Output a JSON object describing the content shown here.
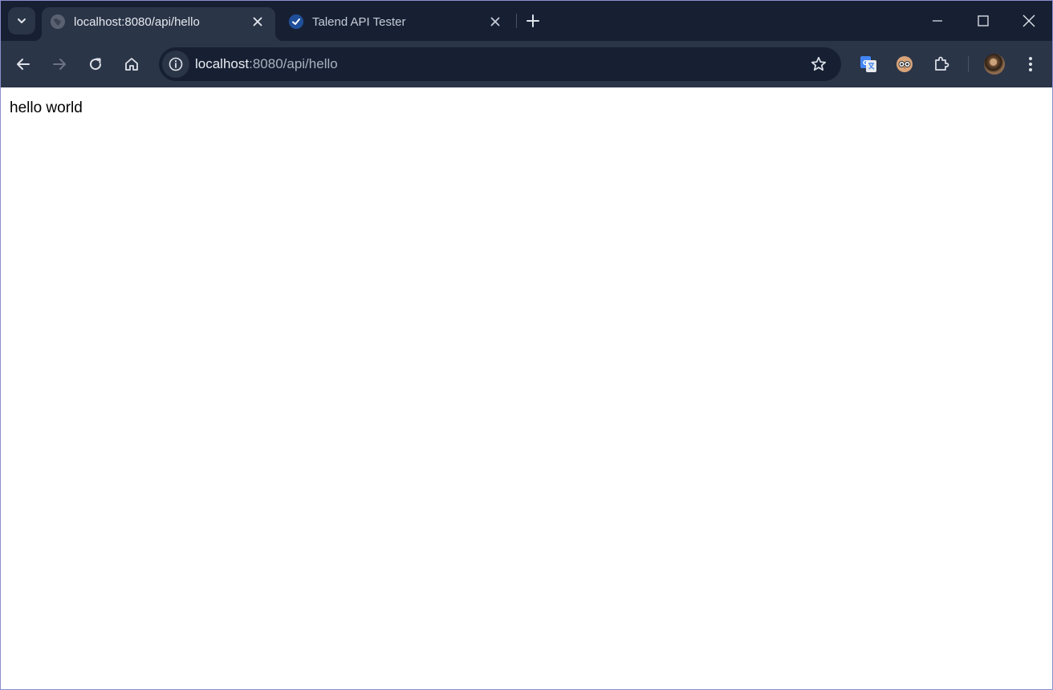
{
  "tabs": [
    {
      "title": "localhost:8080/api/hello",
      "active": true,
      "favicon": "globe-icon"
    },
    {
      "title": "Talend API Tester",
      "active": false,
      "favicon": "check-circle-icon"
    }
  ],
  "address_bar": {
    "url_host": "localhost",
    "url_rest": ":8080/api/hello"
  },
  "page": {
    "body_text": "hello world"
  },
  "colors": {
    "tabstrip_bg": "#172033",
    "toolbar_bg": "#2b3548",
    "omnibox_bg": "#172033",
    "window_border": "#8a8fd0"
  }
}
